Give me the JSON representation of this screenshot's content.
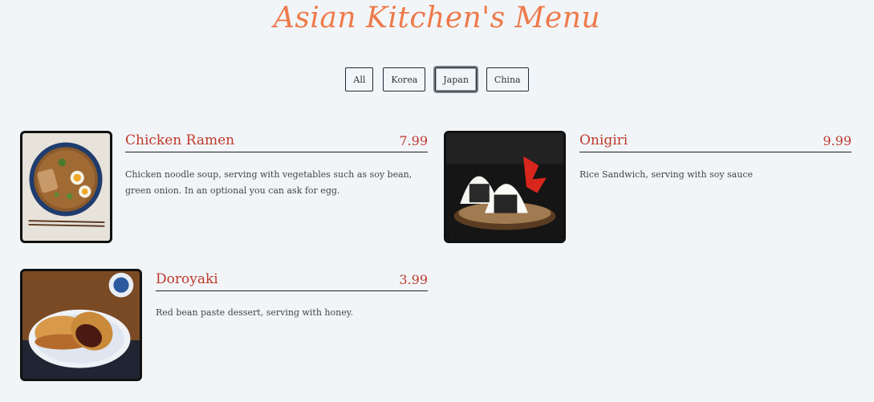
{
  "page": {
    "title": "Asian Kitchen's Menu"
  },
  "filters": [
    {
      "label": "All",
      "active": false
    },
    {
      "label": "Korea",
      "active": false
    },
    {
      "label": "Japan",
      "active": true
    },
    {
      "label": "China",
      "active": false
    }
  ],
  "menu": {
    "items": [
      {
        "name": "Chicken Ramen",
        "price": "7.99",
        "description": "Chicken noodle soup, serving with vegetables such as soy bean, green onion. In an optional you can ask for egg."
      },
      {
        "name": "Onigiri",
        "price": "9.99",
        "description": "Rice Sandwich, serving with soy sauce"
      },
      {
        "name": "Doroyaki",
        "price": "3.99",
        "description": "Red bean paste dessert, serving with honey."
      }
    ]
  },
  "colors": {
    "background": "#f1f5f8",
    "title": "#ee7a4b",
    "item_name": "#c0392b",
    "border": "#111111"
  }
}
